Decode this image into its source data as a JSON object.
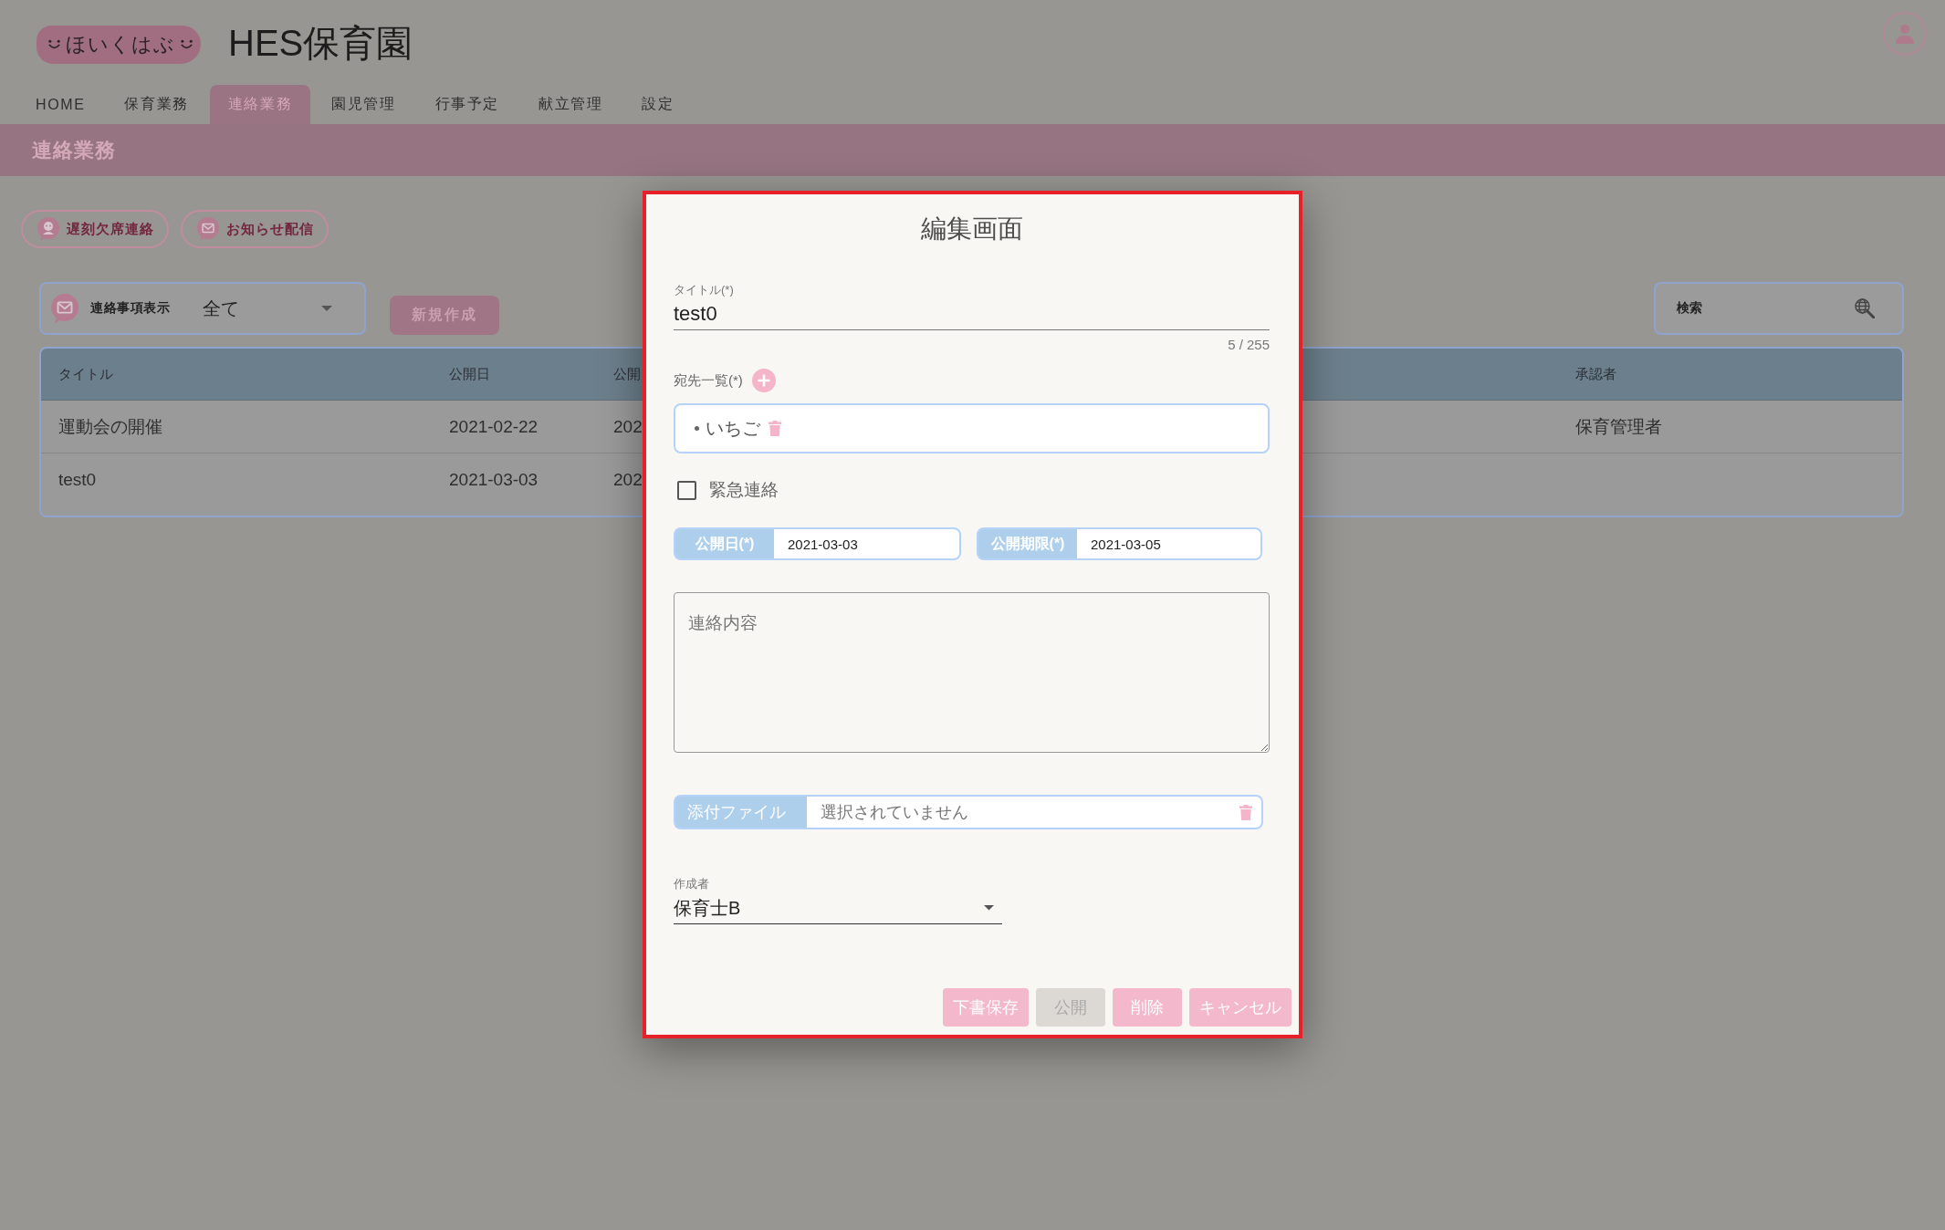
{
  "header": {
    "logo": "ほいくはぶ",
    "title": "HES保育園"
  },
  "nav_tabs": [
    {
      "label": "HOME",
      "selected": false
    },
    {
      "label": "保育業務",
      "selected": false
    },
    {
      "label": "連絡業務",
      "selected": true
    },
    {
      "label": "園児管理",
      "selected": false
    },
    {
      "label": "行事予定",
      "selected": false
    },
    {
      "label": "献立管理",
      "selected": false
    },
    {
      "label": "設定",
      "selected": false
    }
  ],
  "banner": {
    "title": "連絡業務"
  },
  "quick_actions": [
    {
      "label": "遅刻欠席連絡"
    },
    {
      "label": "お知らせ配信"
    }
  ],
  "filter": {
    "label": "連絡事項表示",
    "value": "全て"
  },
  "new_button": {
    "label": "新規作成"
  },
  "search": {
    "placeholder": "検索"
  },
  "table": {
    "columns": [
      "タイトル",
      "公開日",
      "公開",
      "承認者"
    ],
    "rows": [
      {
        "cells": [
          "運動会の開催",
          "2021-02-22",
          "202",
          "保育管理者"
        ]
      },
      {
        "cells": [
          "test0",
          "2021-03-03",
          "202"
        ]
      }
    ]
  },
  "dialog": {
    "title": "編集画面",
    "title_field": {
      "label": "タイトル(*)",
      "value": "test0",
      "counter": "5 / 255"
    },
    "recipients": {
      "label": "宛先一覧(*)",
      "items": [
        {
          "name": "いちご"
        }
      ]
    },
    "urgent": {
      "label": "緊急連絡",
      "checked": false
    },
    "dates": [
      {
        "label": "公開日(*)",
        "value": "2021-03-03"
      },
      {
        "label": "公開期限(*)",
        "value": "2021-03-05"
      }
    ],
    "message": {
      "placeholder": "連絡内容"
    },
    "attachment": {
      "label": "添付ファイル",
      "placeholder": "選択されていません"
    },
    "author": {
      "label": "作成者",
      "value": "保育士B"
    },
    "buttons": [
      {
        "label": "下書保存",
        "disabled": false
      },
      {
        "label": "公開",
        "disabled": true
      },
      {
        "label": "削除",
        "disabled": false
      },
      {
        "label": "キャンセル",
        "disabled": false
      }
    ]
  }
}
